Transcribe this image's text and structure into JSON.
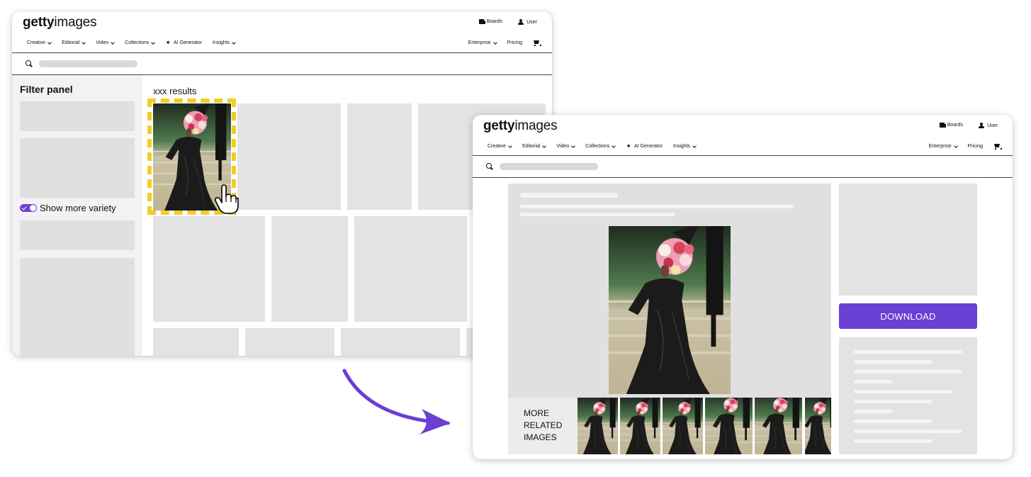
{
  "brand": {
    "bold": "getty",
    "light": "images"
  },
  "header": {
    "boards": "Boards",
    "user": "User"
  },
  "nav": {
    "left": [
      "Creative",
      "Editorial",
      "Video",
      "Collections",
      "AI Generator",
      "Insights"
    ],
    "enterprise": "Enterprise",
    "pricing": "Pricing"
  },
  "search_page": {
    "filter_title": "Filter panel",
    "toggle_label": "Show more variety",
    "results_label": "xxx results"
  },
  "detail_page": {
    "download_label": "DOWNLOAD",
    "related_label": [
      "MORE",
      "RELATED",
      "IMAGES"
    ]
  },
  "colors": {
    "accent": "#6a3fd4",
    "highlight": "#f3cc24",
    "placeholder": "#e3e3e3"
  },
  "icons": [
    "boards-icon",
    "user-icon",
    "chevron-down-icon",
    "sparkle-icon",
    "cart-icon",
    "search-icon",
    "hand-cursor-icon",
    "toggle-check-icon",
    "curved-arrow-icon"
  ]
}
